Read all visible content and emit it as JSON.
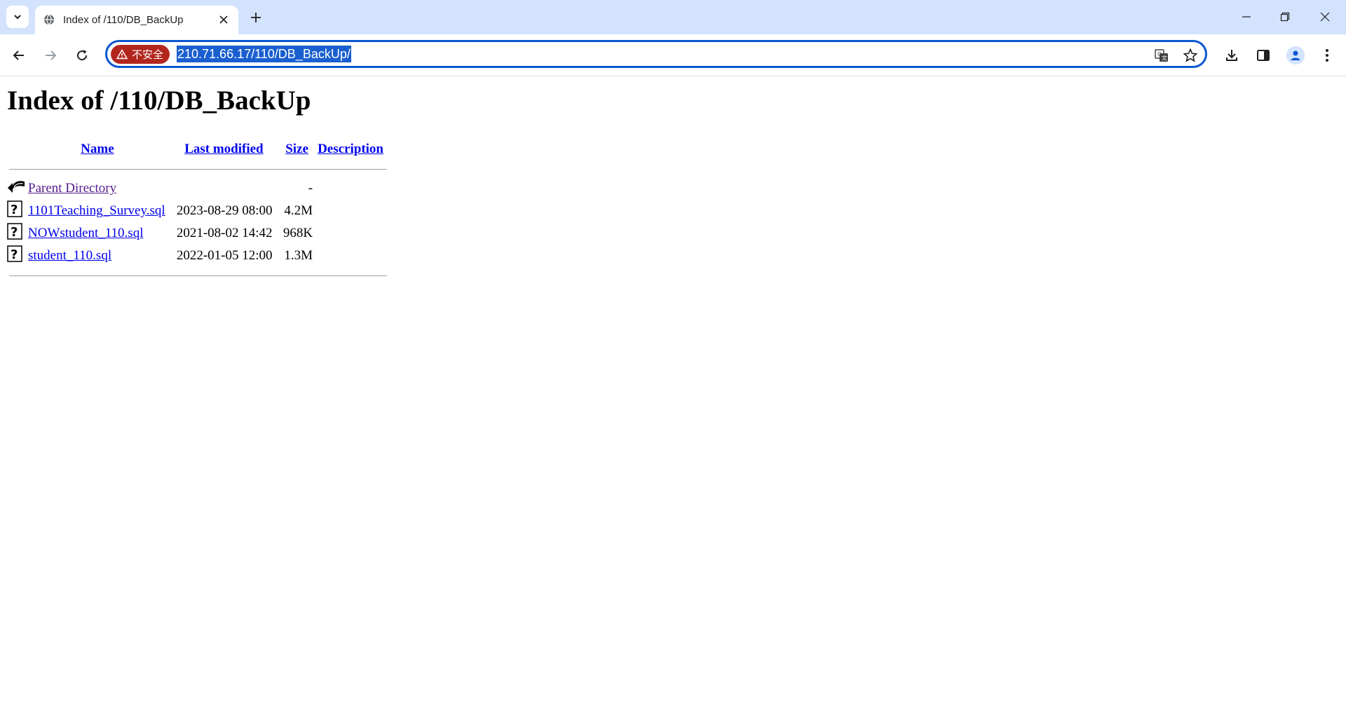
{
  "browser": {
    "tab_title": "Index of /110/DB_BackUp",
    "security_label": "不安全",
    "url": "210.71.66.17/110/DB_BackUp/"
  },
  "page": {
    "heading": "Index of /110/DB_BackUp",
    "columns": [
      "Name",
      "Last modified",
      "Size",
      "Description"
    ],
    "parent": {
      "name": "Parent Directory",
      "size": "-"
    },
    "files": [
      {
        "name": "1101Teaching_Survey.sql",
        "modified": "2023-08-29 08:00",
        "size": "4.2M",
        "icon": "unknown-file-icon"
      },
      {
        "name": "NOWstudent_110.sql",
        "modified": "2021-08-02 14:42",
        "size": "968K",
        "icon": "unknown-file-icon"
      },
      {
        "name": "student_110.sql",
        "modified": "2022-01-05 12:00",
        "size": "1.3M",
        "icon": "unknown-file-icon"
      }
    ]
  },
  "colors": {
    "tabstrip": "#d3e3fd",
    "omnibox_border": "#0b57d0",
    "security_chip": "#b3261e",
    "link": "#0000ee",
    "visited_link": "#551a8b"
  }
}
